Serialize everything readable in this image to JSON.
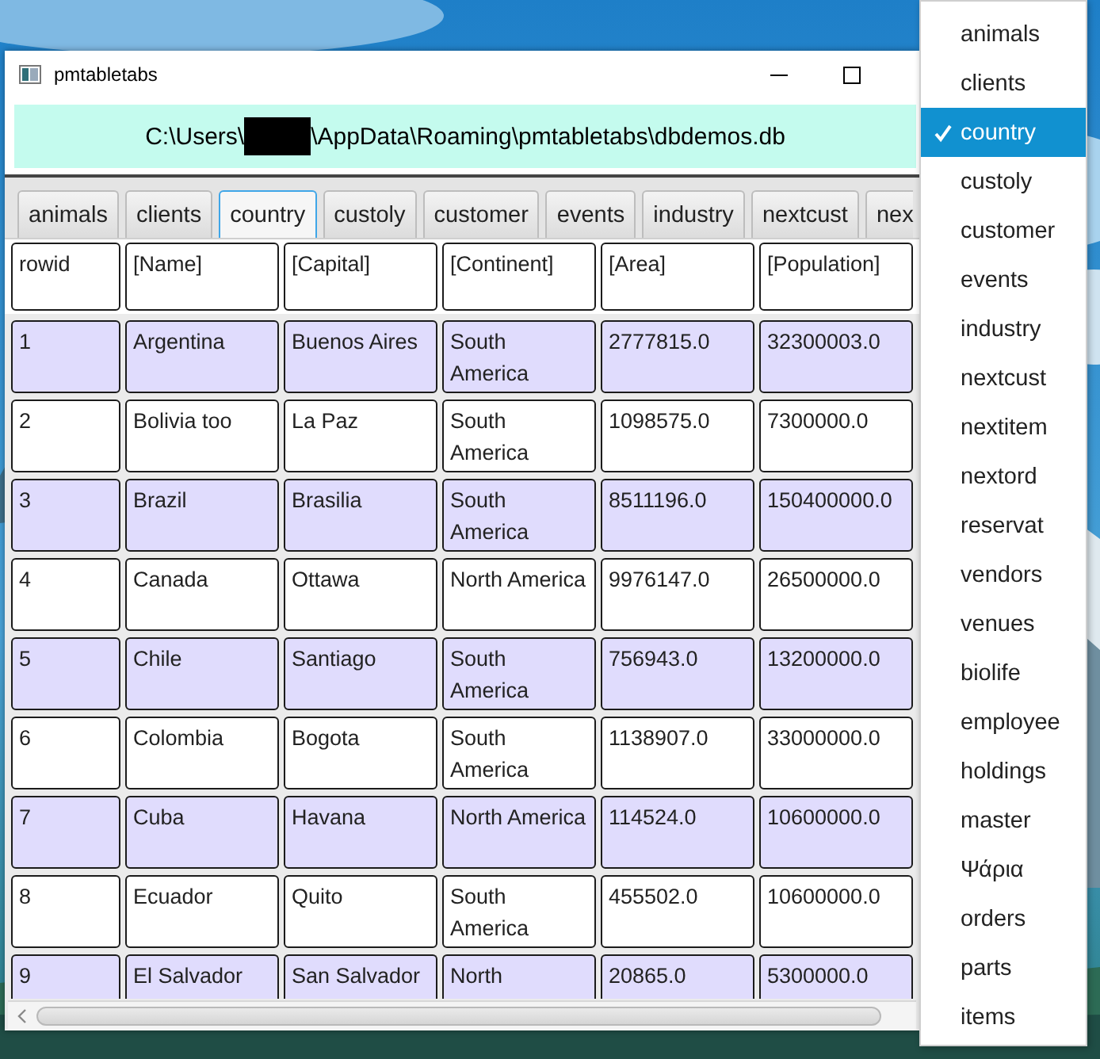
{
  "window": {
    "title": "pmtabletabs"
  },
  "path": {
    "prefix": "C:\\Users\\",
    "suffix": "\\AppData\\Roaming\\pmtabletabs\\dbdemos.db"
  },
  "tabs": [
    {
      "label": "animals",
      "selected": false
    },
    {
      "label": "clients",
      "selected": false
    },
    {
      "label": "country",
      "selected": true
    },
    {
      "label": "custoly",
      "selected": false
    },
    {
      "label": "customer",
      "selected": false
    },
    {
      "label": "events",
      "selected": false
    },
    {
      "label": "industry",
      "selected": false
    },
    {
      "label": "nextcust",
      "selected": false
    },
    {
      "label": "nex",
      "selected": false
    }
  ],
  "table": {
    "columns": [
      "rowid",
      "[Name]",
      "[Capital]",
      "[Continent]",
      "[Area]",
      "[Population]"
    ],
    "rows": [
      [
        "1",
        "Argentina",
        "Buenos Aires",
        "South America",
        "2777815.0",
        "32300003.0"
      ],
      [
        "2",
        "Bolivia too",
        "La Paz",
        "South America",
        "1098575.0",
        "7300000.0"
      ],
      [
        "3",
        "Brazil",
        "Brasilia",
        "South America",
        "8511196.0",
        "150400000.0"
      ],
      [
        "4",
        "Canada",
        "Ottawa",
        "North America",
        "9976147.0",
        "26500000.0"
      ],
      [
        "5",
        "Chile",
        "Santiago",
        "South America",
        "756943.0",
        "13200000.0"
      ],
      [
        "6",
        "Colombia",
        "Bogota",
        "South America",
        "1138907.0",
        "33000000.0"
      ],
      [
        "7",
        "Cuba",
        "Havana",
        "North America",
        "114524.0",
        "10600000.0"
      ],
      [
        "8",
        "Ecuador",
        "Quito",
        "South America",
        "455502.0",
        "10600000.0"
      ],
      [
        "9",
        "El Salvador",
        "San Salvador",
        "North",
        "20865.0",
        "5300000.0"
      ]
    ]
  },
  "menu": {
    "items": [
      {
        "label": "animals",
        "selected": false
      },
      {
        "label": "clients",
        "selected": false
      },
      {
        "label": "country",
        "selected": true
      },
      {
        "label": "custoly",
        "selected": false
      },
      {
        "label": "customer",
        "selected": false
      },
      {
        "label": "events",
        "selected": false
      },
      {
        "label": "industry",
        "selected": false
      },
      {
        "label": "nextcust",
        "selected": false
      },
      {
        "label": "nextitem",
        "selected": false
      },
      {
        "label": "nextord",
        "selected": false
      },
      {
        "label": "reservat",
        "selected": false
      },
      {
        "label": "vendors",
        "selected": false
      },
      {
        "label": "venues",
        "selected": false
      },
      {
        "label": "biolife",
        "selected": false
      },
      {
        "label": "employee",
        "selected": false
      },
      {
        "label": "holdings",
        "selected": false
      },
      {
        "label": "master",
        "selected": false
      },
      {
        "label": "Ψάρια",
        "selected": false
      },
      {
        "label": "orders",
        "selected": false
      },
      {
        "label": "parts",
        "selected": false
      },
      {
        "label": "items",
        "selected": false
      }
    ]
  }
}
